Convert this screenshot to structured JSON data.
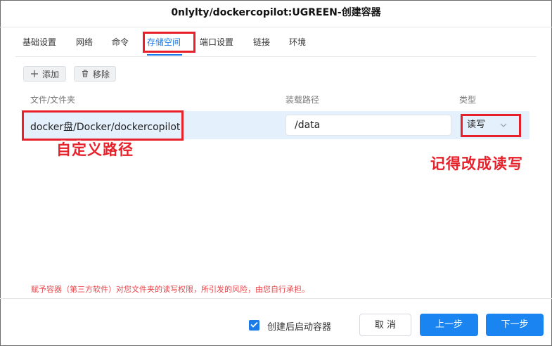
{
  "dialog": {
    "title": "0nlylty/dockercopilot:UGREEN-创建容器"
  },
  "tabs": [
    {
      "label": "基础设置"
    },
    {
      "label": "网络"
    },
    {
      "label": "命令"
    },
    {
      "label": "存储空间"
    },
    {
      "label": "端口设置"
    },
    {
      "label": "链接"
    },
    {
      "label": "环境"
    }
  ],
  "active_tab": "存储空间",
  "toolbar": {
    "add_label": "添加",
    "add_icon": "plus-icon",
    "remove_label": "移除",
    "remove_icon": "trash-icon"
  },
  "table": {
    "headers": [
      "文件/文件夹",
      "装载路径",
      "类型"
    ],
    "rows": [
      {
        "path": "docker盘/Docker/dockercopilot",
        "mount": "/data",
        "type": "读写"
      }
    ]
  },
  "annotations": {
    "custom_path": "自定义路径",
    "remember_rw": "记得改成读写"
  },
  "warning": "赋予容器（第三方软件）对您文件夹的读写权限，所引发的风险，由您自行承担。",
  "footer": {
    "start_after_create_label": "创建后启动容器",
    "start_after_create_checked": true,
    "cancel_label": "取 消",
    "prev_label": "上一步",
    "next_label": "下一步"
  },
  "colors": {
    "accent": "#1a7ae8",
    "annotation_red": "#e8202a",
    "warning_red": "#e8464c",
    "row_highlight": "#e5f0fd"
  }
}
